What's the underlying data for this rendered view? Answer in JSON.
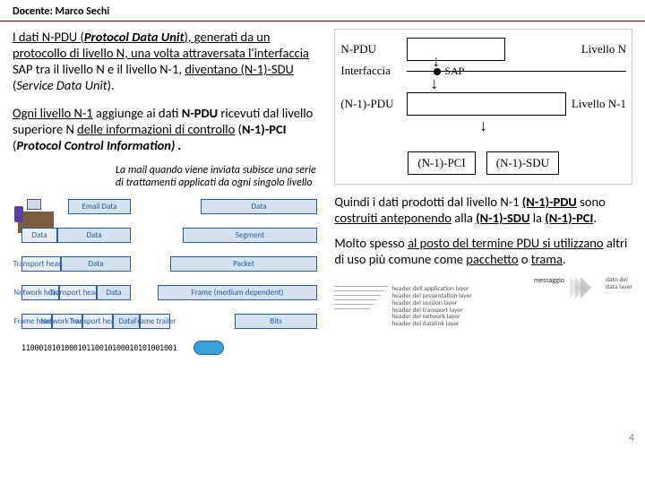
{
  "header": {
    "docente": "Docente: Marco Sechi"
  },
  "left": {
    "p1_a": "I dati N-PDU (",
    "p1_a2": "Protocol Data Unit",
    "p1_a3": "), generati da un protocollo di livello N, una volta ",
    "p1_a4": "attraversata l'interfaccia",
    "p1_a5": " SAP tra il livello N e il livello N-1, ",
    "p1_a6": "diventano (N-1)-SDU",
    "p1_a7": " (",
    "p1_a8": "Service Data Unit",
    "p1_a9": ").",
    "p2_a": "Ogni livello N-1",
    "p2_b": " aggiunge ai dati ",
    "p2_c": "N-PDU",
    "p2_d": " ricevuti dal livello superiore N ",
    "p2_e": "delle informazioni di controllo",
    "p2_f": " (",
    "p2_g": "N-1)-PCI",
    "p2_h": " (",
    "p2_i": "Protocol Control Information) .",
    "caption": "La mail quando viene inviata subisce una serie di trattamenti applicati da ogni singolo livello"
  },
  "right": {
    "diag": {
      "npdu": "N-PDU",
      "livN": "Livello N",
      "iface": "Interfaccia",
      "sap": "SAP",
      "n1pdu": "(N-1)-PDU",
      "livN1": "Livello N-1",
      "pci": "(N-1)-PCI",
      "sdu": "(N-1)-SDU"
    },
    "p3_a": "Quindi i dati prodotti dal livello N-1 ",
    "p3_b": "(N-1)-PDU",
    "p3_c": " sono ",
    "p3_d": "costruiti anteponendo",
    "p3_e": " alla ",
    "p3_f": "(N-1)-SDU",
    "p3_g": " la ",
    "p3_h": "(N-1)-PCI",
    "p3_i": ".",
    "p4_a": "Molto spesso ",
    "p4_b": "al posto del termine PDU si utilizzano",
    "p4_c": " altri di uso più comune come ",
    "p4_d": "pacchetto",
    "p4_e": " o ",
    "p4_f": "trama",
    "p4_g": ".",
    "msg": {
      "title": "messaggio",
      "col1a": "header dell application layer",
      "col1b": "header del presentation layer",
      "col1c": "header del session layer",
      "col1d": "header del transport layer",
      "col1e": "header del network layer",
      "col1f": "header del datalink layer",
      "col2a": "dato del",
      "col2b": "data layer"
    }
  },
  "encaps": {
    "email": "Email Data",
    "data_h": "Data",
    "data": "Data",
    "th": "Transport header",
    "seg": "Segment",
    "nh": "Network header",
    "pkt": "Packet",
    "fh": "Frame header",
    "ft": "Frame trailer",
    "frm": "Frame (medium dependent)",
    "bits": "Bits",
    "bitstream": "110001010100010110010100010101001001"
  },
  "pagenum": "4"
}
